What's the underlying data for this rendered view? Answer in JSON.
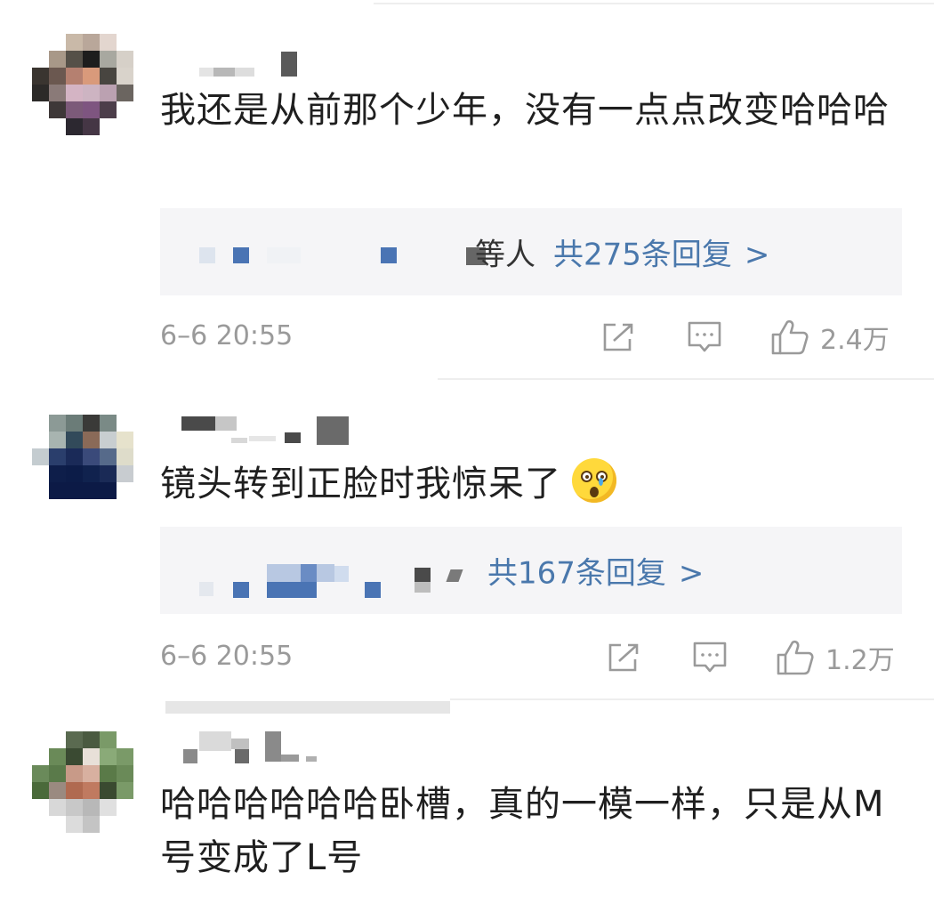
{
  "comments": [
    {
      "text": "我还是从前那个少年，没有一点点改变哈哈哈",
      "reply_prefix": "等人",
      "reply_label": "共275条回复",
      "reply_chevron": ">",
      "timestamp": "6–6 20:55",
      "likes": "2.4万"
    },
    {
      "text": "镜头转到正脸时我惊呆了",
      "text_emoji": "surprised-face-emoji",
      "reply_label": "共167条回复",
      "reply_chevron": ">",
      "timestamp": "6–6 20:55",
      "likes": "1.2万"
    },
    {
      "text": "哈哈哈哈哈哈卧槽，真的一模一样，只是从M号变成了L号"
    }
  ],
  "icons": {
    "share": "share-icon",
    "comment": "comment-icon",
    "like": "thumbs-up-icon"
  },
  "colors": {
    "reply_link": "#4a78ac",
    "reply_box_bg": "#f5f5f7",
    "meta_text": "#9a9a9a"
  }
}
